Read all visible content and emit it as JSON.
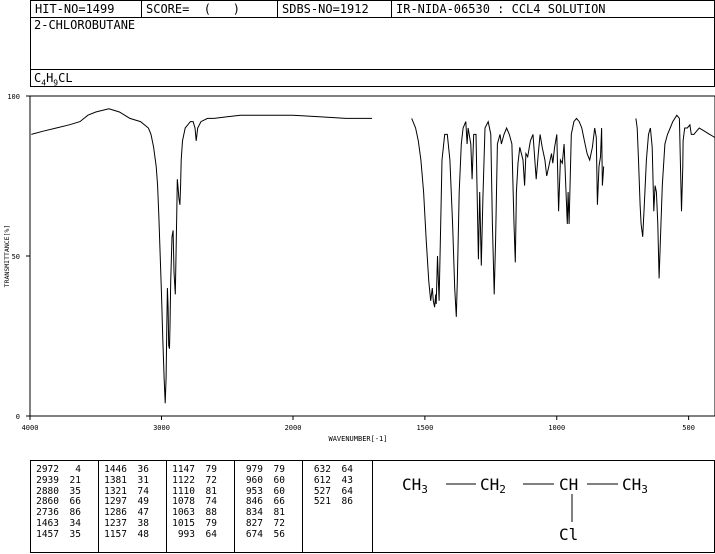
{
  "header": {
    "hit_no": "HIT-NO=1499",
    "score": "SCORE=  (   )",
    "sdbs_no": "SDBS-NO=1912",
    "ir_no": "IR-NIDA-06530 : CCL4 SOLUTION"
  },
  "compound": {
    "name": "2-CHLOROBUTANE",
    "formula": {
      "c": "C",
      "c_n": "4",
      "h": "H",
      "h_n": "9",
      "rest": "CL"
    }
  },
  "chart_data": {
    "type": "line",
    "xlabel": "WAVENUMBER[-1]",
    "ylabel": "TRANSMITTANCE[%]",
    "x_ticks": [
      "4000",
      "3000",
      "2000",
      "1500",
      "1000",
      "500"
    ],
    "y_ticks": [
      "100",
      "50",
      "0"
    ],
    "xlim": [
      4000,
      400
    ],
    "ylim": [
      0,
      100
    ],
    "series": [
      {
        "name": "",
        "segments": [
          [
            [
              3990,
              88
            ],
            [
              3900,
              89
            ],
            [
              3800,
              90
            ],
            [
              3700,
              91
            ],
            [
              3620,
              92
            ],
            [
              3560,
              94
            ],
            [
              3500,
              95
            ],
            [
              3450,
              95.5
            ],
            [
              3400,
              96
            ],
            [
              3360,
              95.5
            ],
            [
              3320,
              95
            ],
            [
              3280,
              94
            ],
            [
              3240,
              93
            ],
            [
              3200,
              92.5
            ],
            [
              3160,
              92
            ],
            [
              3130,
              91
            ],
            [
              3100,
              90
            ],
            [
              3080,
              88
            ],
            [
              3060,
              84
            ],
            [
              3040,
              78
            ],
            [
              3030,
              72
            ],
            [
              3020,
              62
            ],
            [
              3010,
              50
            ],
            [
              3000,
              38
            ],
            [
              2990,
              24
            ],
            [
              2980,
              12
            ],
            [
              2972,
              4
            ],
            [
              2965,
              12
            ],
            [
              2960,
              28
            ],
            [
              2955,
              40
            ],
            [
              2950,
              34
            ],
            [
              2945,
              22
            ],
            [
              2939,
              21
            ],
            [
              2935,
              28
            ],
            [
              2930,
              42
            ],
            [
              2920,
              56
            ],
            [
              2912,
              58
            ],
            [
              2905,
              45
            ],
            [
              2895,
              38
            ],
            [
              2890,
              50
            ],
            [
              2884,
              64
            ],
            [
              2880,
              74
            ],
            [
              2875,
              72
            ],
            [
              2868,
              68
            ],
            [
              2860,
              66
            ],
            [
              2855,
              72
            ],
            [
              2850,
              80
            ],
            [
              2840,
              86
            ],
            [
              2820,
              90
            ],
            [
              2800,
              91
            ],
            [
              2780,
              92
            ],
            [
              2760,
              92
            ],
            [
              2745,
              90
            ],
            [
              2736,
              86
            ],
            [
              2725,
              90
            ],
            [
              2700,
              92
            ],
            [
              2650,
              93
            ],
            [
              2600,
              93
            ],
            [
              2500,
              93.5
            ],
            [
              2400,
              94
            ],
            [
              2300,
              94
            ],
            [
              2200,
              94
            ],
            [
              2100,
              94
            ],
            [
              2000,
              94
            ],
            [
              1900,
              93.5
            ],
            [
              1800,
              93
            ],
            [
              1700,
              93
            ]
          ],
          [
            [
              1550,
              93
            ],
            [
              1535,
              90
            ],
            [
              1525,
              86
            ],
            [
              1515,
              80
            ],
            [
              1505,
              70
            ],
            [
              1495,
              55
            ],
            [
              1485,
              42
            ],
            [
              1478,
              36
            ],
            [
              1472,
              40
            ],
            [
              1468,
              36
            ],
            [
              1463,
              34
            ],
            [
              1459,
              38
            ],
            [
              1457,
              35
            ],
            [
              1452,
              50
            ],
            [
              1446,
              36
            ],
            [
              1440,
              60
            ],
            [
              1435,
              80
            ],
            [
              1425,
              88
            ],
            [
              1415,
              88
            ],
            [
              1405,
              80
            ],
            [
              1395,
              60
            ],
            [
              1387,
              40
            ],
            [
              1381,
              31
            ],
            [
              1377,
              42
            ],
            [
              1370,
              70
            ],
            [
              1362,
              85
            ],
            [
              1355,
              90
            ],
            [
              1345,
              92
            ],
            [
              1340,
              85
            ],
            [
              1336,
              90
            ],
            [
              1326,
              85
            ],
            [
              1321,
              74
            ],
            [
              1315,
              88
            ],
            [
              1306,
              88
            ],
            [
              1297,
              49
            ],
            [
              1292,
              70
            ],
            [
              1286,
              47
            ],
            [
              1280,
              68
            ],
            [
              1272,
              90
            ],
            [
              1260,
              92
            ],
            [
              1250,
              88
            ],
            [
              1244,
              60
            ],
            [
              1237,
              38
            ],
            [
              1232,
              55
            ],
            [
              1225,
              85
            ],
            [
              1215,
              88
            ],
            [
              1210,
              85
            ],
            [
              1200,
              88
            ],
            [
              1190,
              90
            ],
            [
              1180,
              88
            ],
            [
              1170,
              85
            ],
            [
              1162,
              60
            ],
            [
              1157,
              48
            ],
            [
              1153,
              70
            ],
            [
              1147,
              79
            ],
            [
              1140,
              84
            ],
            [
              1128,
              80
            ],
            [
              1122,
              72
            ],
            [
              1117,
              82
            ],
            [
              1110,
              81
            ],
            [
              1100,
              86
            ],
            [
              1090,
              88
            ],
            [
              1078,
              74
            ],
            [
              1070,
              82
            ],
            [
              1063,
              88
            ],
            [
              1055,
              84
            ],
            [
              1045,
              80
            ],
            [
              1038,
              75
            ],
            [
              1030,
              78
            ],
            [
              1020,
              82
            ],
            [
              1015,
              79
            ],
            [
              1008,
              84
            ],
            [
              1000,
              88
            ],
            [
              993,
              64
            ],
            [
              986,
              80
            ],
            [
              979,
              79
            ],
            [
              972,
              85
            ],
            [
              960,
              60
            ],
            [
              957,
              70
            ],
            [
              953,
              60
            ],
            [
              945,
              88
            ],
            [
              935,
              92
            ],
            [
              925,
              93
            ],
            [
              915,
              92
            ],
            [
              905,
              90
            ],
            [
              895,
              86
            ],
            [
              885,
              82
            ],
            [
              875,
              80
            ],
            [
              865,
              84
            ],
            [
              856,
              90
            ],
            [
              850,
              87
            ],
            [
              846,
              66
            ],
            [
              840,
              78
            ],
            [
              834,
              81
            ],
            [
              830,
              90
            ],
            [
              827,
              72
            ],
            [
              822,
              78
            ]
          ],
          [
            [
              700,
              93
            ],
            [
              695,
              90
            ],
            [
              690,
              80
            ],
            [
              684,
              66
            ],
            [
              680,
              60
            ],
            [
              674,
              56
            ],
            [
              668,
              66
            ],
            [
              660,
              80
            ],
            [
              652,
              88
            ],
            [
              645,
              90
            ],
            [
              638,
              84
            ],
            [
              632,
              64
            ],
            [
              627,
              72
            ],
            [
              622,
              70
            ],
            [
              617,
              60
            ],
            [
              612,
              43
            ],
            [
              607,
              55
            ],
            [
              600,
              72
            ],
            [
              590,
              85
            ],
            [
              580,
              88
            ],
            [
              570,
              90
            ],
            [
              560,
              92
            ],
            [
              545,
              94
            ],
            [
              535,
              93
            ],
            [
              527,
              64
            ],
            [
              522,
              78
            ],
            [
              521,
              86
            ],
            [
              515,
              90
            ],
            [
              505,
              90
            ],
            [
              495,
              91
            ],
            [
              490,
              88
            ],
            [
              480,
              88
            ],
            [
              470,
              89
            ],
            [
              460,
              90
            ],
            [
              450,
              89.5
            ],
            [
              440,
              89
            ],
            [
              430,
              88.5
            ],
            [
              420,
              88
            ],
            [
              410,
              87.5
            ],
            [
              400,
              87
            ]
          ]
        ]
      }
    ],
    "peak_table": [
      [
        [
          "2972",
          "4"
        ],
        [
          "2939",
          "21"
        ],
        [
          "2880",
          "35"
        ],
        [
          "2860",
          "66"
        ],
        [
          "2736",
          "86"
        ],
        [
          "1463",
          "34"
        ],
        [
          "1457",
          "35"
        ]
      ],
      [
        [
          "1446",
          "36"
        ],
        [
          "1381",
          "31"
        ],
        [
          "1321",
          "74"
        ],
        [
          "1297",
          "49"
        ],
        [
          "1286",
          "47"
        ],
        [
          "1237",
          "38"
        ],
        [
          "1157",
          "48"
        ]
      ],
      [
        [
          "1147",
          "79"
        ],
        [
          "1122",
          "72"
        ],
        [
          "1110",
          "81"
        ],
        [
          "1078",
          "74"
        ],
        [
          "1063",
          "88"
        ],
        [
          "1015",
          "79"
        ],
        [
          "993",
          "64"
        ]
      ],
      [
        [
          "979",
          "79"
        ],
        [
          "960",
          "60"
        ],
        [
          "953",
          "60"
        ],
        [
          "846",
          "66"
        ],
        [
          "834",
          "81"
        ],
        [
          "827",
          "72"
        ],
        [
          "674",
          "56"
        ]
      ],
      [
        [
          "632",
          "64"
        ],
        [
          "612",
          "43"
        ],
        [
          "527",
          "64"
        ],
        [
          "521",
          "86"
        ]
      ]
    ]
  },
  "structure": {
    "ch3_left": "CH",
    "ch3_left_sub": "3",
    "ch2": "CH",
    "ch2_sub": "2",
    "ch": "CH",
    "ch3_right": "CH",
    "ch3_right_sub": "3",
    "cl": "Cl"
  }
}
